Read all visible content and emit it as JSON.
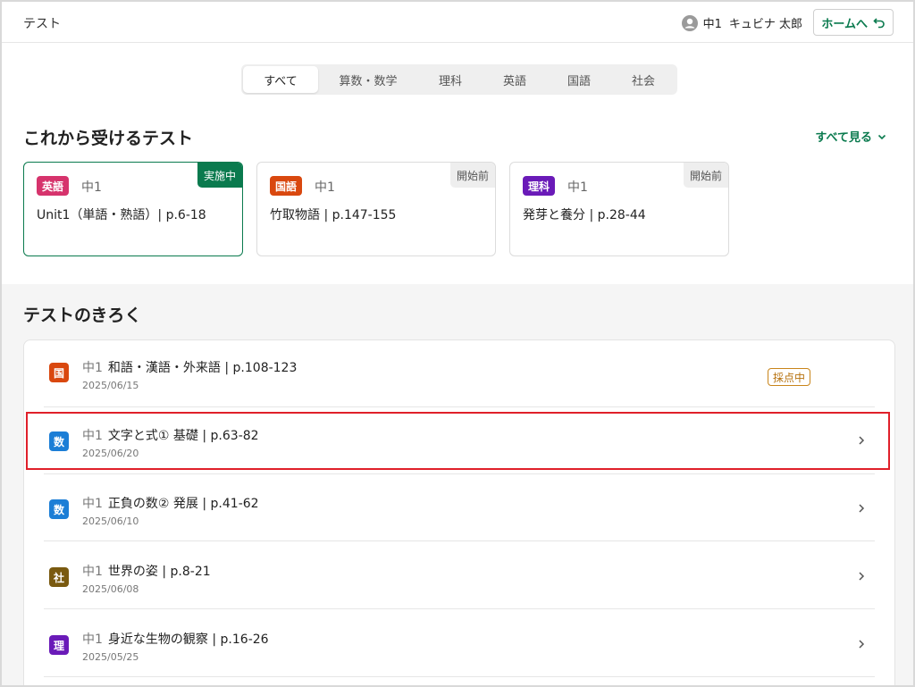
{
  "header": {
    "title": "テスト",
    "user_grade": "中1",
    "user_name": "キュビナ 太郎",
    "home_label": "ホームへ"
  },
  "tabs": [
    {
      "label": "すべて",
      "active": true
    },
    {
      "label": "算数・数学"
    },
    {
      "label": "理科"
    },
    {
      "label": "英語"
    },
    {
      "label": "国語"
    },
    {
      "label": "社会"
    }
  ],
  "upcoming": {
    "section_title": "これから受けるテスト",
    "see_all_label": "すべて見る",
    "cards": [
      {
        "subject": "英語",
        "subject_color": "#d6336c",
        "grade": "中1",
        "title": "Unit1（単語・熟語）| p.6-18",
        "status": "実施中"
      },
      {
        "subject": "国語",
        "subject_color": "#d9480f",
        "grade": "中1",
        "title": "竹取物語 | p.147-155",
        "status": "開始前"
      },
      {
        "subject": "理科",
        "subject_color": "#6a1ab8",
        "grade": "中1",
        "title": "発芽と養分 | p.28-44",
        "status": "開始前"
      }
    ]
  },
  "history": {
    "section_title": "テストのきろく",
    "rows": [
      {
        "icon": "国",
        "icon_color": "#d9480f",
        "grade": "中1",
        "title": "和語・漢語・外来語 | p.108-123",
        "date": "2025/06/15",
        "badge": "採点中"
      },
      {
        "icon": "数",
        "icon_color": "#1c7ed6",
        "grade": "中1",
        "title": "文字と式① 基礎 | p.63-82",
        "date": "2025/06/20"
      },
      {
        "icon": "数",
        "icon_color": "#1c7ed6",
        "grade": "中1",
        "title": "正負の数② 発展 | p.41-62",
        "date": "2025/06/10"
      },
      {
        "icon": "社",
        "icon_color": "#7a5a10",
        "grade": "中1",
        "title": "世界の姿 | p.8-21",
        "date": "2025/06/08"
      },
      {
        "icon": "理",
        "icon_color": "#6a1ab8",
        "grade": "中1",
        "title": "身近な生物の観察 | p.16-26",
        "date": "2025/05/25"
      }
    ]
  }
}
